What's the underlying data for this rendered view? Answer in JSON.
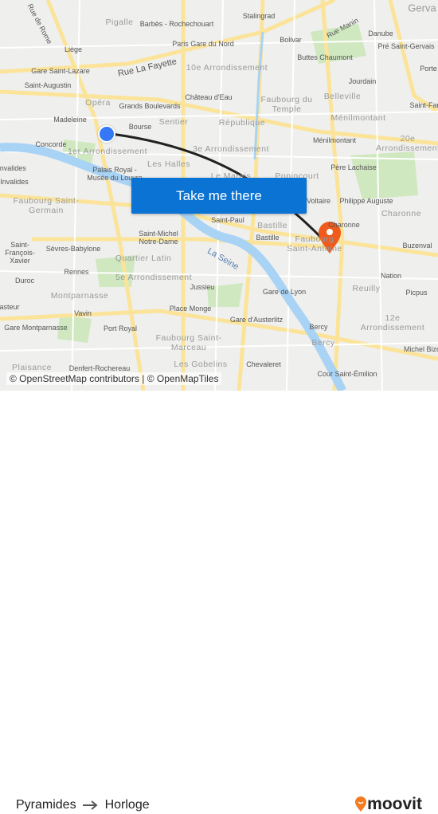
{
  "map": {
    "labels": [
      "Rue de Rome",
      "Pigalle",
      "Barbès - Rochechouart",
      "Stalingrad",
      "Rue Manin",
      "Gerva",
      "Liège",
      "Paris Gare du Nord",
      "Bolivar",
      "Danube",
      "Pré Saint-Gervais",
      "Gare Saint-Lazare",
      "Rue La Fayette",
      "10e Arrondissement",
      "Buttes Chaumont",
      "Saint-Augustin",
      "Jourdain",
      "Porte",
      "Opéra",
      "Grands Boulevards",
      "Château d'Eau",
      "Faubourg du Temple",
      "Belleville",
      "Saint-Far",
      "Madeleine",
      "Bourse",
      "Sentier",
      "République",
      "Ménilmontant",
      "Concorde",
      "1er Arrondissement",
      "3e Arrondissement",
      "Ménilmontant",
      "20e Arrondissement",
      "Invalides",
      "Palais Royal - Musée du Louvre",
      "Les Halles",
      "Le Marais",
      "Popincourt",
      "Père Lachaise",
      "Invalides",
      "Voltaire",
      "Philippe Auguste",
      "Faubourg Saint-Germain",
      "Saint-Paul",
      "Bastille",
      "Charonne",
      "Charonne",
      "Saint-Michel Notre-Dame",
      "Bastille",
      "Faubourg Saint-Antoine",
      "Saint-François-Xavier",
      "Sèvres-Babylone",
      "La Seine",
      "Buzenval",
      "Quartier Latin",
      "Rennes",
      "5e Arrondissement",
      "Nation",
      "Duroc",
      "Jussieu",
      "Reuilly",
      "Montparnasse",
      "Gare de Lyon",
      "Picpus",
      "Vavin",
      "Place Monge",
      "asteur",
      "Gare Montparnasse",
      "Port Royal",
      "Gare d'Austerlitz",
      "12e Arrondissement",
      "Faubourg Saint-Marceau",
      "Bercy",
      "Bercy",
      "Michel Bizo",
      "Les Gobelins",
      "Chevaleret",
      "Plaisance",
      "Denfert-Rochereau",
      "Cour Saint-Émilion"
    ],
    "attribution": "© OpenStreetMap contributors | © OpenMapTiles",
    "cta_label": "Take me there",
    "colors": {
      "water": "#a9d3f5",
      "road": "#fbe49a",
      "park": "#cfe8c0",
      "route": "#222222",
      "origin": "#3478f6",
      "destination": "#f05a1a",
      "cta": "#0b73d4"
    }
  },
  "footer": {
    "origin": "Pyramides",
    "destination": "Horloge",
    "arrow_icon": "arrow-right-icon",
    "brand": "moovit"
  }
}
